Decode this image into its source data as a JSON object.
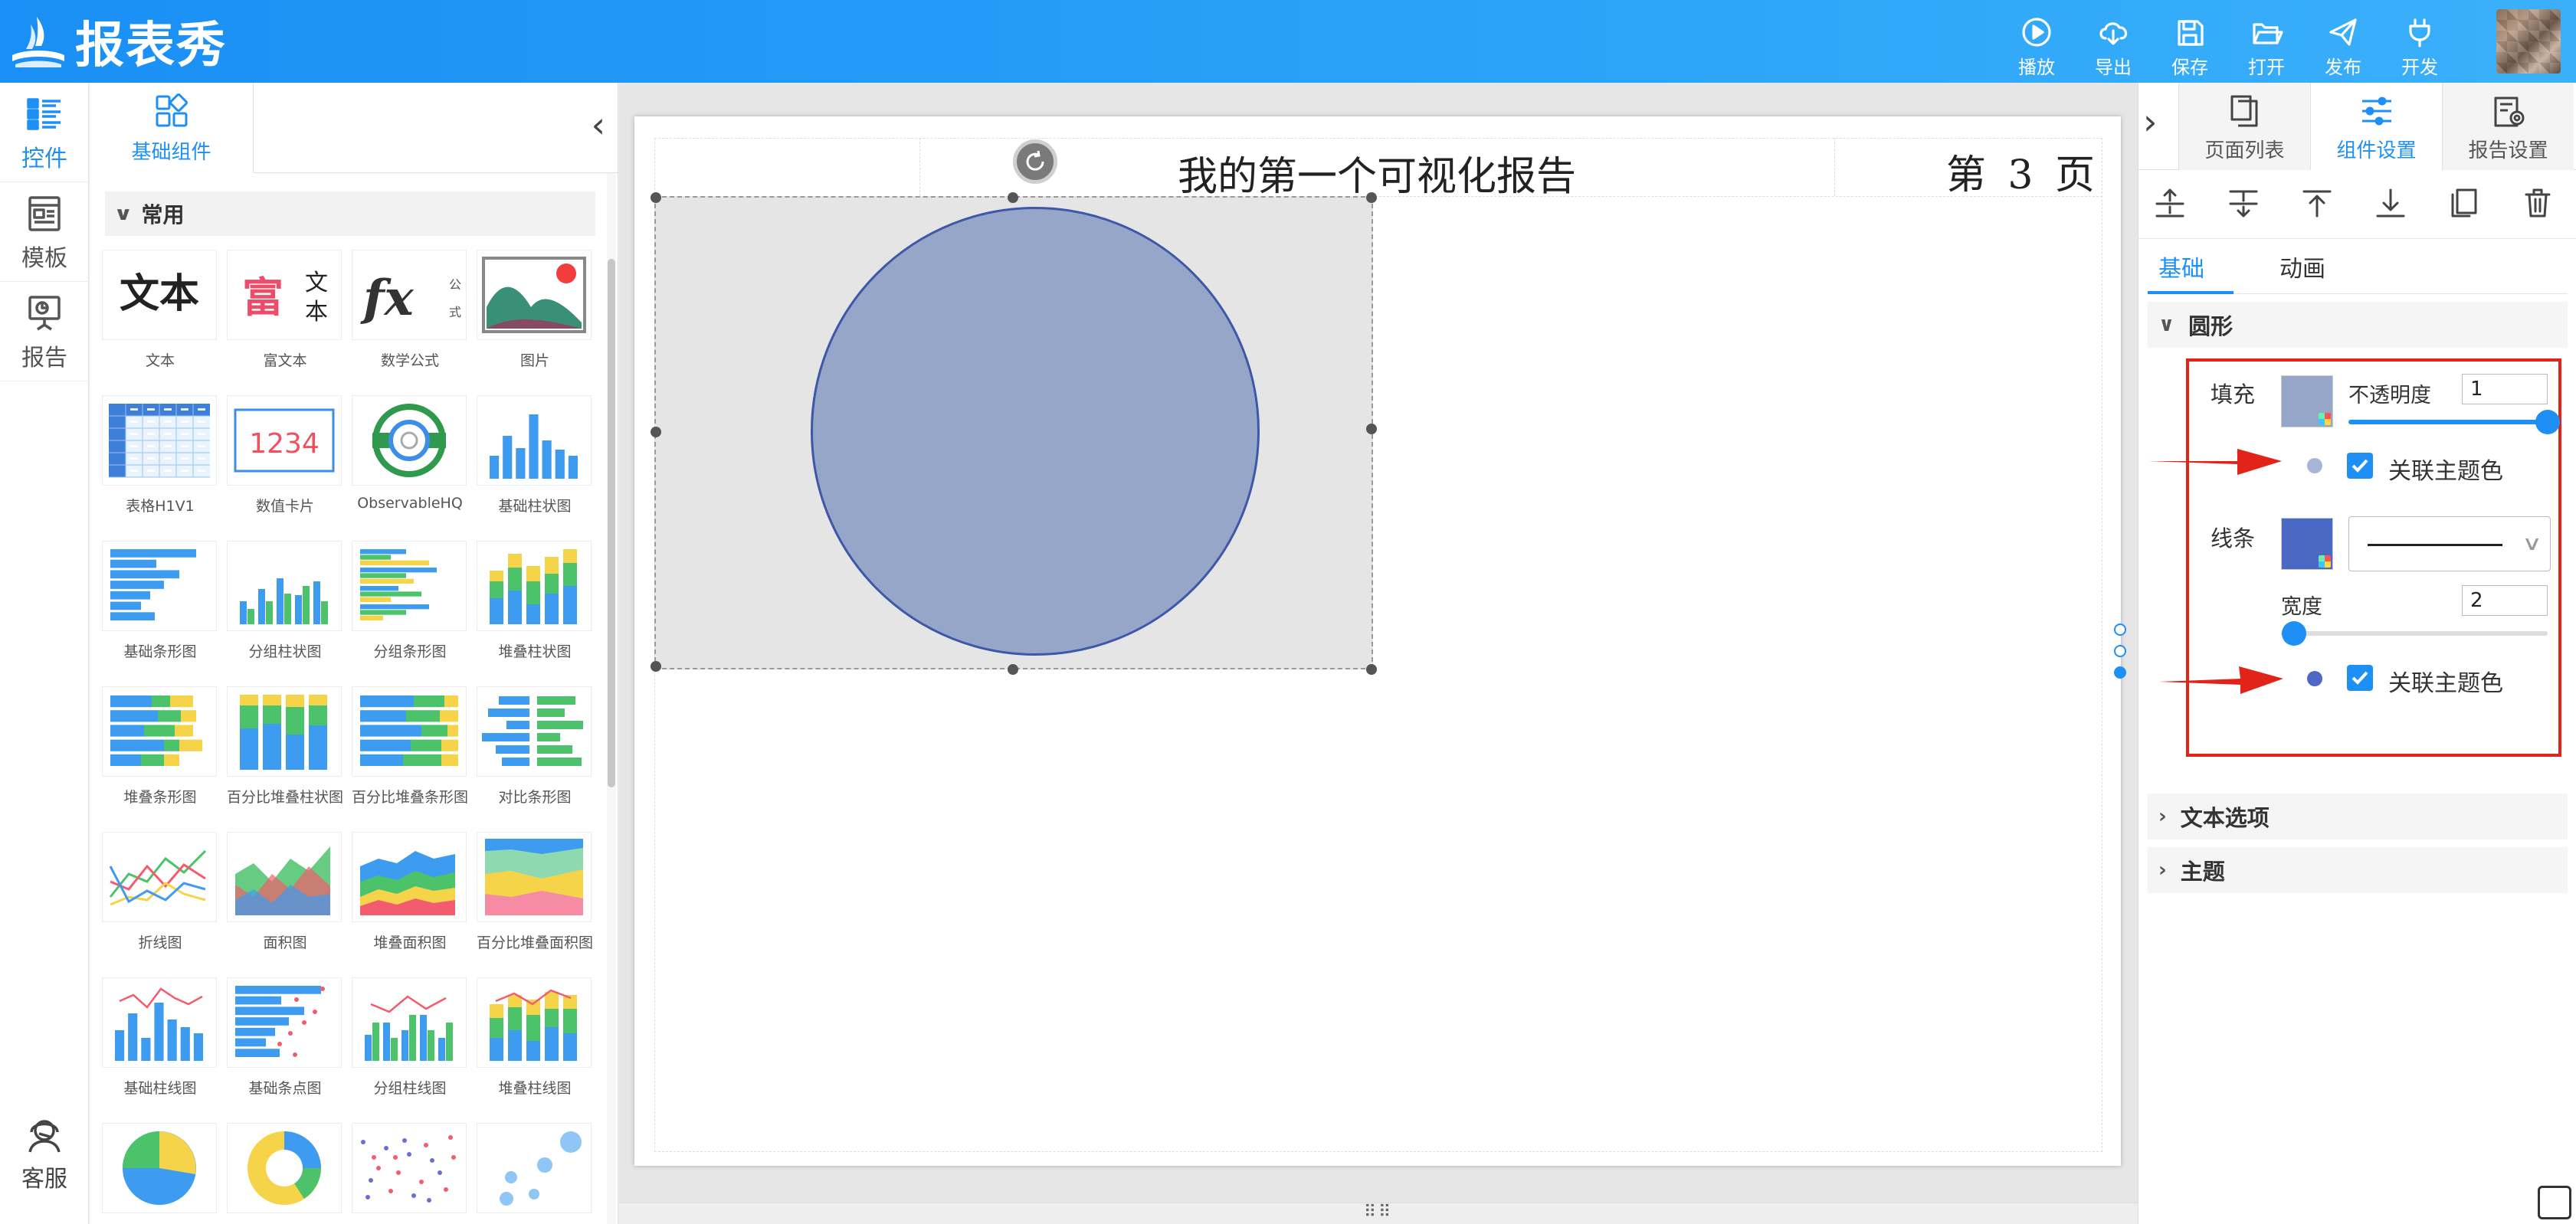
{
  "app": {
    "name": "报表秀"
  },
  "toolbar": {
    "items": [
      {
        "label": "播放",
        "icon": "play-icon"
      },
      {
        "label": "导出",
        "icon": "cloud-download-icon"
      },
      {
        "label": "保存",
        "icon": "save-icon"
      },
      {
        "label": "打开",
        "icon": "folder-open-icon"
      },
      {
        "label": "发布",
        "icon": "send-icon"
      },
      {
        "label": "开发",
        "icon": "plug-icon"
      }
    ]
  },
  "rail": {
    "items": [
      {
        "label": "控件",
        "icon": "list-icon",
        "active": true
      },
      {
        "label": "模板",
        "icon": "template-icon",
        "active": false
      },
      {
        "label": "报告",
        "icon": "presentation-icon",
        "active": false
      }
    ],
    "service": {
      "label": "客服",
      "icon": "headset-icon"
    }
  },
  "components": {
    "tab": "基础组件",
    "section": "常用",
    "items": [
      {
        "label": "文本",
        "thumb": "text"
      },
      {
        "label": "富文本",
        "thumb": "richtext"
      },
      {
        "label": "数学公式",
        "thumb": "formula"
      },
      {
        "label": "图片",
        "thumb": "image"
      },
      {
        "label": "表格H1V1",
        "thumb": "table"
      },
      {
        "label": "数值卡片",
        "thumb": "numcard",
        "value": "1234"
      },
      {
        "label": "ObservableHQ",
        "thumb": "observable"
      },
      {
        "label": "基础柱状图",
        "thumb": "bar"
      },
      {
        "label": "基础条形图",
        "thumb": "hbar"
      },
      {
        "label": "分组柱状图",
        "thumb": "groupbar"
      },
      {
        "label": "分组条形图",
        "thumb": "grouphbar"
      },
      {
        "label": "堆叠柱状图",
        "thumb": "stackbar"
      },
      {
        "label": "堆叠条形图",
        "thumb": "stackhbar"
      },
      {
        "label": "百分比堆叠柱状图",
        "thumb": "pctstackbar"
      },
      {
        "label": "百分比堆叠条形图",
        "thumb": "pctstackhbar"
      },
      {
        "label": "对比条形图",
        "thumb": "comparehbar"
      },
      {
        "label": "折线图",
        "thumb": "line"
      },
      {
        "label": "面积图",
        "thumb": "area"
      },
      {
        "label": "堆叠面积图",
        "thumb": "stackarea"
      },
      {
        "label": "百分比堆叠面积图",
        "thumb": "pctstackarea"
      },
      {
        "label": "基础柱线图",
        "thumb": "barline"
      },
      {
        "label": "基础条点图",
        "thumb": "hbardot"
      },
      {
        "label": "分组柱线图",
        "thumb": "groupbarline"
      },
      {
        "label": "堆叠柱线图",
        "thumb": "stackbarline"
      },
      {
        "label": "",
        "thumb": "pie"
      },
      {
        "label": "",
        "thumb": "donut"
      },
      {
        "label": "",
        "thumb": "scatter"
      },
      {
        "label": "",
        "thumb": "bubble"
      }
    ]
  },
  "report": {
    "title": "我的第一个可视化报告",
    "page_label": "第 3 页"
  },
  "settings": {
    "tabs": [
      {
        "label": "页面列表",
        "icon": "pages-icon"
      },
      {
        "label": "组件设置",
        "icon": "sliders-icon",
        "active": true
      },
      {
        "label": "报告设置",
        "icon": "report-settings-icon"
      }
    ],
    "tools": [
      "align-middle-icon",
      "align-center-icon",
      "bring-to-top-icon",
      "send-to-bottom-icon",
      "copy-icon",
      "delete-icon"
    ],
    "subtabs": [
      {
        "label": "基础",
        "active": true
      },
      {
        "label": "动画",
        "active": false
      }
    ],
    "shape_group": "圆形",
    "fill": {
      "label": "填充",
      "color": "#95a6c8",
      "opacity_label": "不透明度",
      "opacity": "1",
      "opacity_value": 1.0,
      "theme_dot_color": "#a9b5d6",
      "link_theme_label": "关联主题色",
      "link_theme": true
    },
    "stroke": {
      "label": "线条",
      "color": "#4a69c4",
      "width_label": "宽度",
      "width": "2",
      "width_fraction": 0.05,
      "theme_dot_color": "#4f68c6",
      "link_theme_label": "关联主题色",
      "link_theme": true
    },
    "groups": [
      {
        "label": "文本选项"
      },
      {
        "label": "主题"
      }
    ]
  }
}
